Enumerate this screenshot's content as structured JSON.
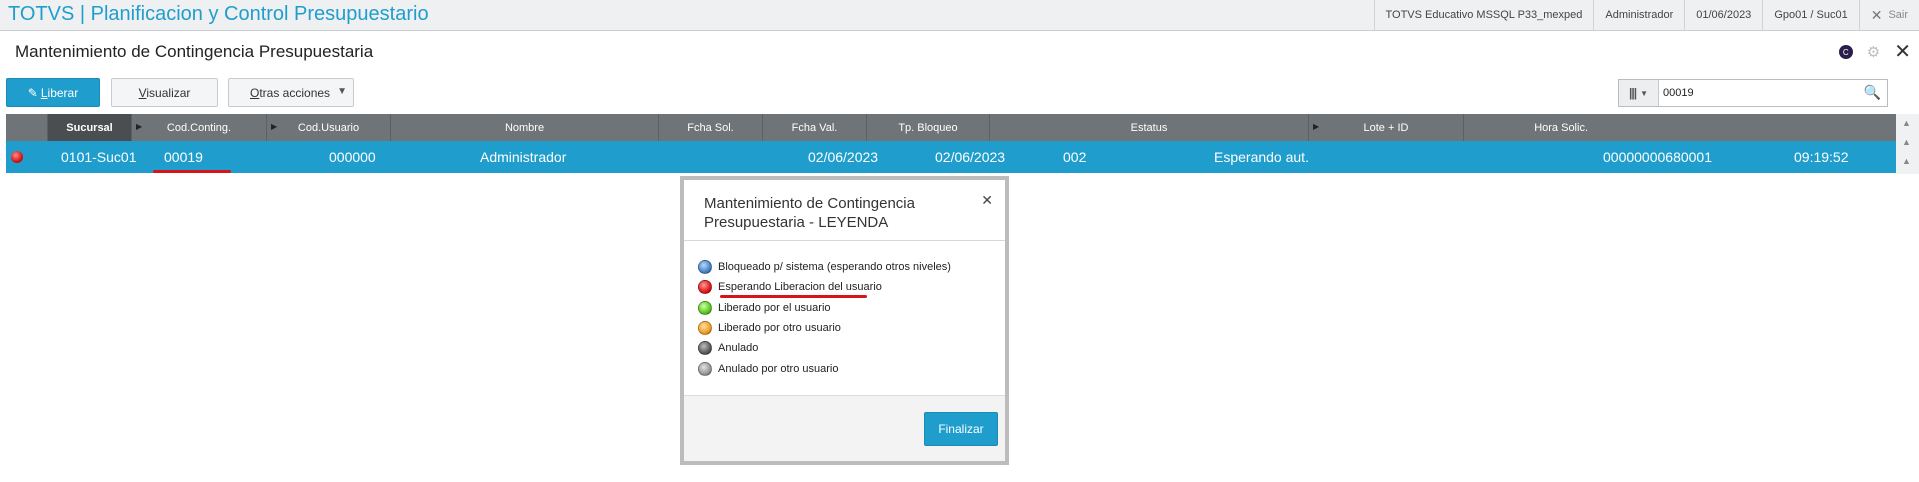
{
  "topbar": {
    "app_title": "TOTVS | Planificacion y Control Presupuestario",
    "environment": "TOTVS Educativo MSSQL P33_mexped",
    "user": "Administrador",
    "date": "01/06/2023",
    "branch": "Gpo01 / Suc01",
    "exit_label": "Sair"
  },
  "page": {
    "title": "Mantenimiento de Contingencia Presupuestaria",
    "badge_letter": "C"
  },
  "toolbar": {
    "liberar_label": "Liberar",
    "visualizar_label": "Visualizar",
    "otras_label": "Otras acciones"
  },
  "search": {
    "value": "00019"
  },
  "grid": {
    "columns": [
      "Sucursal",
      "Cod.Conting.",
      "Cod.Usuario",
      "Nombre",
      "Fcha Sol.",
      "Fcha Val.",
      "Tp. Bloqueo",
      "Estatus",
      "Lote + ID",
      "Hora Solic."
    ],
    "row": {
      "sucursal": "0101-Suc01",
      "cod_conting": "00019",
      "cod_usuario": "000000",
      "nombre": "Administrador",
      "fcha_sol": "02/06/2023",
      "fcha_val": "02/06/2023",
      "tp_bloqueo": "002",
      "estatus": "Esperando aut.",
      "lote_id": "00000000680001",
      "hora_solic": "09:19:52",
      "status_color": "#d41414"
    }
  },
  "dialog": {
    "title": "Mantenimiento de Contingencia Presupuestaria - LEYENDA",
    "legend": [
      {
        "label": "Bloqueado p/ sistema (esperando otros niveles)",
        "color": "blue"
      },
      {
        "label": "Esperando Liberacion del usuario",
        "color": "red"
      },
      {
        "label": "Liberado por el usuario",
        "color": "green"
      },
      {
        "label": "Liberado por otro usuario",
        "color": "orange"
      },
      {
        "label": "Anulado",
        "color": "dark-grey"
      },
      {
        "label": "Anulado por otro usuario",
        "color": "grey"
      }
    ],
    "finalizar_label": "Finalizar"
  },
  "colors": {
    "accent": "#1f9ecd",
    "header_grey": "#6f7478",
    "annotation_red": "#d8141b"
  }
}
